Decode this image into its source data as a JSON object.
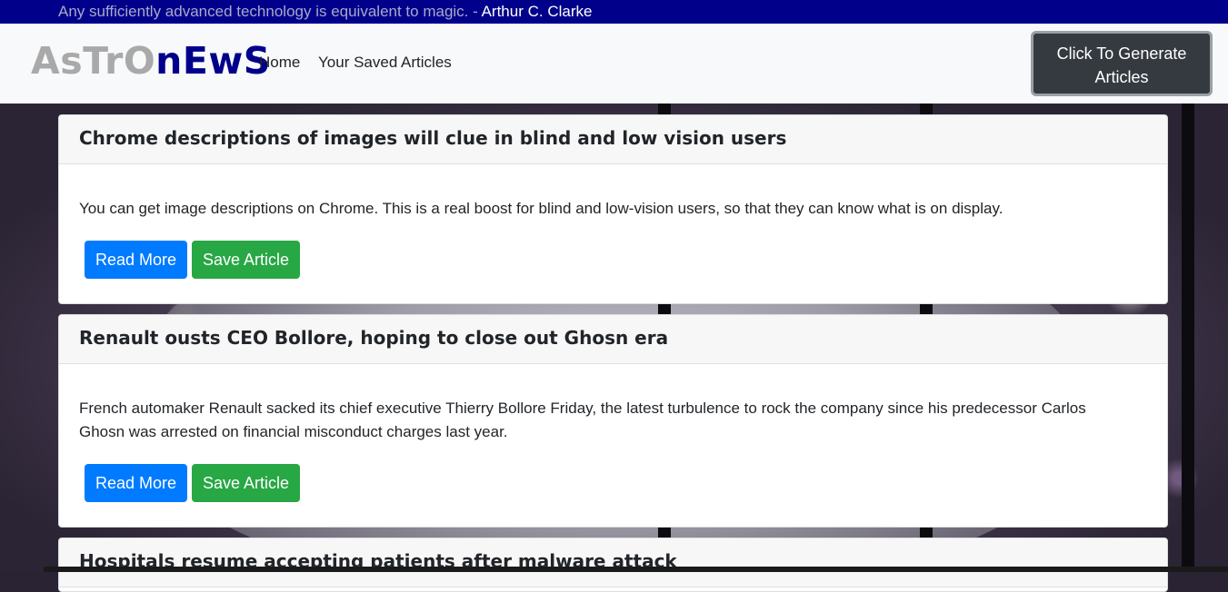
{
  "quote": {
    "text": "Any sufficiently advanced technology is equivalent to magic. - ",
    "author": "Arthur C. Clarke"
  },
  "navbar": {
    "brand_part1": "AsTrO",
    "brand_part2": "nEwS",
    "links": [
      "Home",
      "Your Saved Articles"
    ],
    "generate_label": "Click To Generate Articles"
  },
  "articles": [
    {
      "title": "Chrome descriptions of images will clue in blind and low vision users",
      "summary": "You can get image descriptions on Chrome. This is a real boost for blind and low-vision users, so that they can know what is on display.",
      "read_label": "Read More",
      "save_label": "Save Article"
    },
    {
      "title": "Renault ousts CEO Bollore, hoping to close out Ghosn era",
      "summary": "French automaker Renault sacked its chief executive Thierry Bollore Friday, the latest turbulence to rock the company since his predecessor Carlos Ghosn was arrested on financial misconduct charges last year.",
      "read_label": "Read More",
      "save_label": "Save Article"
    },
    {
      "title": "Hospitals resume accepting patients after malware attack"
    }
  ],
  "colors": {
    "quote_bar": "#00008b",
    "brand_dark": "#00008b",
    "brand_light": "#a9a9a9",
    "read_button": "#007bff",
    "save_button": "#28a745",
    "generate_button": "#343a40"
  }
}
